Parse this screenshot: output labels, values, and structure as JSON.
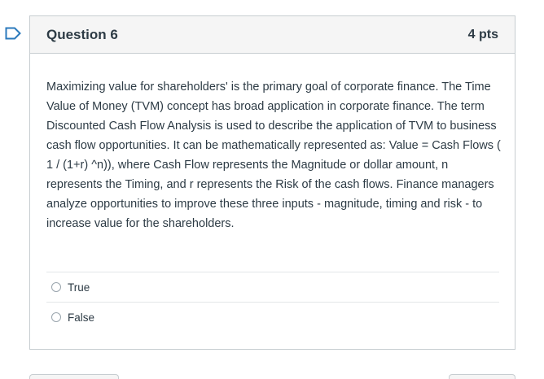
{
  "question": {
    "title": "Question 6",
    "points": "4 pts",
    "flag_icon": "bookmark-flag-icon",
    "text": "Maximizing value for shareholders' is the primary goal of corporate finance. The Time Value of Money (TVM) concept has broad application in corporate finance. The term Discounted Cash Flow Analysis is used to describe the application of TVM to business cash flow opportunities. It can be mathematically represented as: Value = Cash Flows ( 1 / (1+r) ^n)), where Cash Flow represents the Magnitude or dollar amount, n represents the Timing, and r represents the Risk of the cash flows. Finance managers analyze opportunities to improve these three inputs - magnitude, timing and risk - to increase value for the shareholders.",
    "answers": [
      {
        "label": "True",
        "selected": false
      },
      {
        "label": "False",
        "selected": false
      }
    ]
  },
  "colors": {
    "accent": "#2b7abc",
    "border": "#c7cdd1",
    "text": "#2d3b45",
    "header_bg": "#f5f5f5"
  }
}
